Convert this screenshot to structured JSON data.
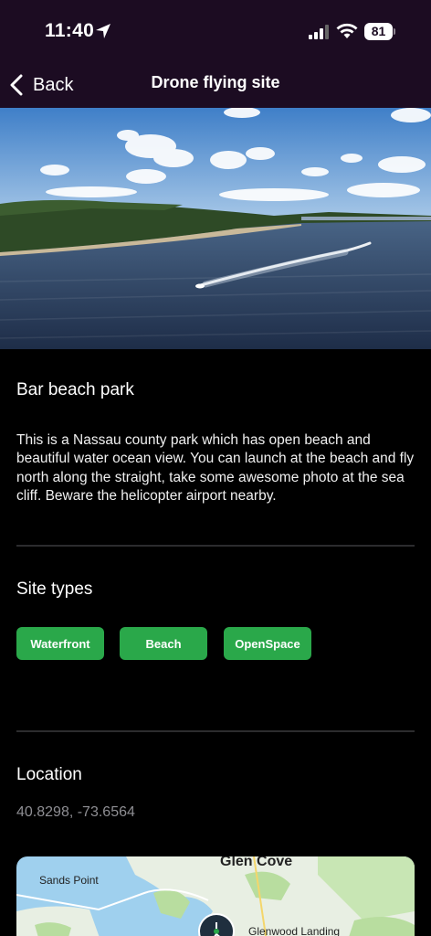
{
  "status_bar": {
    "time": "11:40",
    "battery": "81"
  },
  "nav": {
    "back_label": "Back",
    "title": "Drone flying site"
  },
  "site": {
    "name": "Bar beach park",
    "description": "This is a Nassau county park which has open beach and beautiful water ocean view. You can launch at the beach and fly north along the straight, take some awesome photo at the sea cliff. Beware the helicopter airport nearby."
  },
  "site_types": {
    "title": "Site types",
    "tags": [
      "Waterfront",
      "Beach",
      "OpenSpace"
    ],
    "tag_color": "#2aa84a"
  },
  "location": {
    "title": "Location",
    "coordinates": "40.8298, -73.6564"
  },
  "map": {
    "labels": [
      "Glen Cove",
      "Sands Point",
      "Glenwood Landing"
    ]
  },
  "colors": {
    "header_bg": "#1c0c22",
    "background": "#000000",
    "accent": "#2aa84a"
  }
}
